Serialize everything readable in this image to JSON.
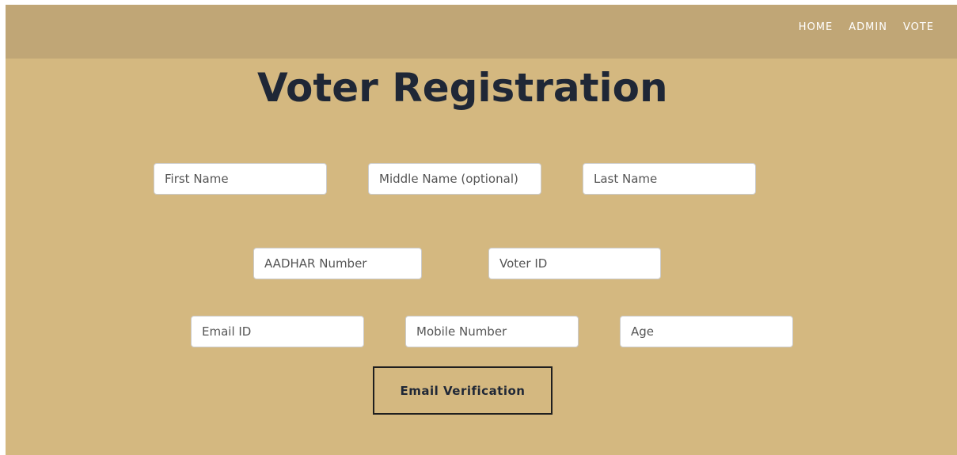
{
  "nav": {
    "items": [
      {
        "label": "HOME"
      },
      {
        "label": "ADMIN"
      },
      {
        "label": "VOTE"
      }
    ]
  },
  "page": {
    "title": "Voter Registration"
  },
  "form": {
    "first_name": {
      "value": "",
      "placeholder": "First Name"
    },
    "middle_name": {
      "value": "",
      "placeholder": "Middle Name (optional)"
    },
    "last_name": {
      "value": "",
      "placeholder": "Last Name"
    },
    "aadhar": {
      "value": "",
      "placeholder": "AADHAR Number"
    },
    "voter_id": {
      "value": "",
      "placeholder": "Voter ID"
    },
    "email": {
      "value": "",
      "placeholder": "Email ID"
    },
    "mobile": {
      "value": "",
      "placeholder": "Mobile Number"
    },
    "age": {
      "value": "",
      "placeholder": "Age"
    },
    "verify_label": "Email Verification"
  },
  "colors": {
    "navbar": "#c0a676",
    "background": "#d4b880",
    "title": "#1f2736"
  }
}
